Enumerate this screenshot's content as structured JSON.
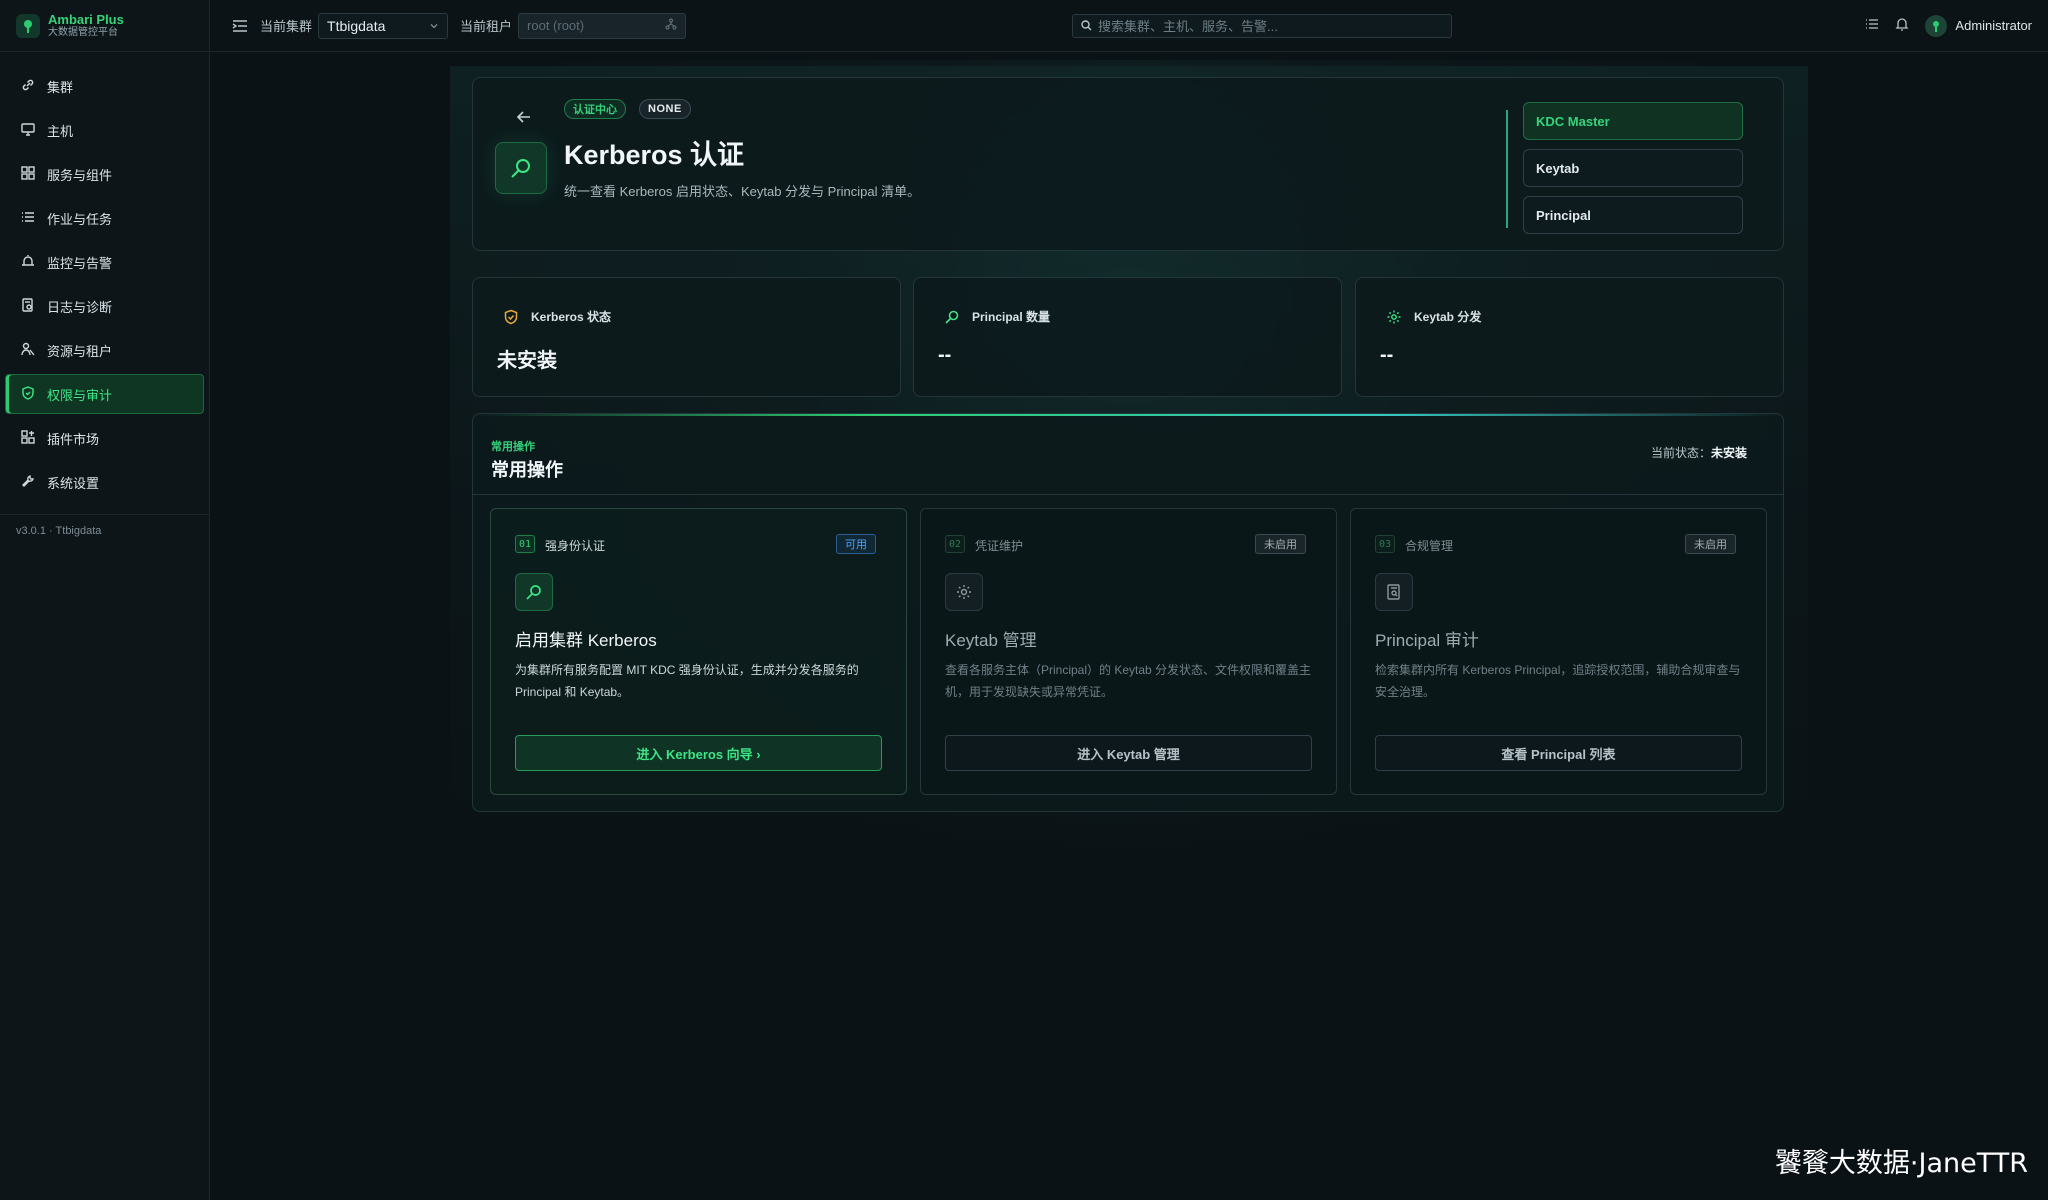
{
  "brand": {
    "title": "Ambari Plus",
    "subtitle": "大数据管控平台"
  },
  "sidebar": {
    "items": [
      {
        "label": "集群",
        "icon": "link-icon"
      },
      {
        "label": "主机",
        "icon": "monitor-icon"
      },
      {
        "label": "服务与组件",
        "icon": "grid-icon"
      },
      {
        "label": "作业与任务",
        "icon": "list-icon"
      },
      {
        "label": "监控与告警",
        "icon": "alarm-icon"
      },
      {
        "label": "日志与诊断",
        "icon": "log-icon"
      },
      {
        "label": "资源与租户",
        "icon": "users-icon"
      },
      {
        "label": "权限与审计",
        "icon": "shield-icon",
        "active": true
      },
      {
        "label": "插件市场",
        "icon": "plugin-icon"
      },
      {
        "label": "系统设置",
        "icon": "wrench-icon"
      }
    ],
    "version": "v3.0.1 · Ttbigdata"
  },
  "topbar": {
    "cluster_label": "当前集群",
    "cluster_value": "Ttbigdata",
    "tenant_label": "当前租户",
    "tenant_placeholder": "root (root)",
    "search_placeholder": "搜索集群、主机、服务、告警...",
    "user": "Administrator"
  },
  "hero": {
    "tag_primary": "认证中心",
    "tag_secondary": "NONE",
    "title": "Kerberos 认证",
    "description": "统一查看 Kerberos 启用状态、Keytab 分发与 Principal 清单。",
    "links": [
      "KDC Master",
      "Keytab",
      "Principal"
    ],
    "active_link": "KDC Master"
  },
  "stats": [
    {
      "label": "Kerberos 状态",
      "value": "未安装",
      "icon": "shield-check-icon"
    },
    {
      "label": "Principal 数量",
      "value": "--",
      "icon": "search-icon"
    },
    {
      "label": "Keytab 分发",
      "value": "--",
      "icon": "gear-icon"
    }
  ],
  "operations": {
    "kicker": "常用操作",
    "title": "常用操作",
    "status_label": "当前状态：",
    "status_value": "未安装",
    "items": [
      {
        "num": "01",
        "category": "强身份认证",
        "badge": "可用",
        "title": "启用集群 Kerberos",
        "description": "为集群所有服务配置 MIT KDC 强身份认证，生成并分发各服务的 Principal 和 Keytab。",
        "button": "进入 Kerberos 向导 ›",
        "icon": "search-icon"
      },
      {
        "num": "02",
        "category": "凭证维护",
        "badge": "未启用",
        "title": "Keytab 管理",
        "description": "查看各服务主体（Principal）的 Keytab 分发状态、文件权限和覆盖主机，用于发现缺失或异常凭证。",
        "button": "进入 Keytab 管理",
        "icon": "gear-icon"
      },
      {
        "num": "03",
        "category": "合规管理",
        "badge": "未启用",
        "title": "Principal 审计",
        "description": "检索集群内所有 Kerberos Principal，追踪授权范围，辅助合规审查与安全治理。",
        "button": "查看 Principal 列表",
        "icon": "document-search-icon"
      }
    ]
  },
  "watermark": "饕餮大数据·JaneTTR",
  "colors": {
    "accent": "#2ecc71",
    "background": "#0b1216",
    "info": "#4ba3ff"
  }
}
